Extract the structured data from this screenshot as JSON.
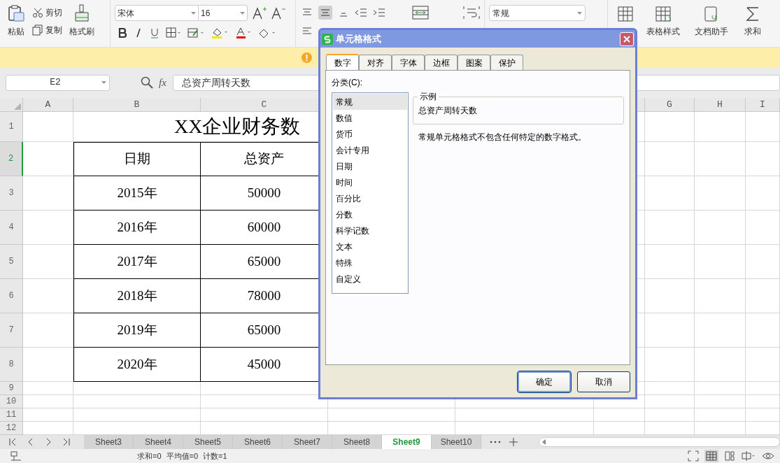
{
  "ribbon": {
    "paste": "粘贴",
    "cut": "剪切",
    "copy": "复制",
    "format_painter": "格式刷",
    "font_name": "宋体",
    "font_size": "16",
    "number_format": "常规",
    "right_buttons": [
      {
        "label": "表格样式"
      },
      {
        "label": "文档助手"
      },
      {
        "label": "求和"
      }
    ]
  },
  "formula_bar": {
    "cell_ref": "E2",
    "fx": "fx",
    "value": "总资产周转天数"
  },
  "sheet": {
    "columns_left": [
      "A",
      "B",
      "C"
    ],
    "columns_right": [
      "G",
      "H",
      "I"
    ],
    "rows": [
      {
        "label": "1",
        "selected": false
      },
      {
        "label": "2",
        "selected": true
      },
      {
        "label": "3",
        "selected": false
      },
      {
        "label": "4",
        "selected": false
      },
      {
        "label": "5",
        "selected": false
      },
      {
        "label": "6",
        "selected": false
      },
      {
        "label": "7",
        "selected": false
      },
      {
        "label": "8",
        "selected": false
      },
      {
        "label": "9",
        "selected": false
      },
      {
        "label": "10",
        "selected": false
      },
      {
        "label": "11",
        "selected": false
      },
      {
        "label": "12",
        "selected": false
      }
    ],
    "title": "XX企业财务数",
    "table_header": [
      "日期",
      "总资产"
    ],
    "table_rows": [
      [
        "2015年",
        "50000"
      ],
      [
        "2016年",
        "60000"
      ],
      [
        "2017年",
        "65000"
      ],
      [
        "2018年",
        "78000"
      ],
      [
        "2019年",
        "65000"
      ],
      [
        "2020年",
        "45000"
      ]
    ]
  },
  "sheet_tabs": [
    {
      "label": "Sheet3",
      "selected": false
    },
    {
      "label": "Sheet4",
      "selected": false
    },
    {
      "label": "Sheet5",
      "selected": false
    },
    {
      "label": "Sheet6",
      "selected": false
    },
    {
      "label": "Sheet7",
      "selected": false
    },
    {
      "label": "Sheet8",
      "selected": false
    },
    {
      "label": "Sheet9",
      "selected": true
    },
    {
      "label": "Sheet10",
      "selected": false
    }
  ],
  "status_bar": {
    "sum": "求和=0",
    "average": "平均值=0",
    "count": "计数=1"
  },
  "dialog": {
    "title": "单元格格式",
    "tabs": [
      {
        "label": "数字",
        "selected": true
      },
      {
        "label": "对齐",
        "selected": false
      },
      {
        "label": "字体",
        "selected": false
      },
      {
        "label": "边框",
        "selected": false
      },
      {
        "label": "图案",
        "selected": false
      },
      {
        "label": "保护",
        "selected": false
      }
    ],
    "category_label": "分类(C):",
    "categories": [
      {
        "label": "常规",
        "selected": true
      },
      {
        "label": "数值",
        "selected": false
      },
      {
        "label": "货币",
        "selected": false
      },
      {
        "label": "会计专用",
        "selected": false
      },
      {
        "label": "日期",
        "selected": false
      },
      {
        "label": "时间",
        "selected": false
      },
      {
        "label": "百分比",
        "selected": false
      },
      {
        "label": "分数",
        "selected": false
      },
      {
        "label": "科学记数",
        "selected": false
      },
      {
        "label": "文本",
        "selected": false
      },
      {
        "label": "特殊",
        "selected": false
      },
      {
        "label": "自定义",
        "selected": false
      }
    ],
    "sample_label": "示例",
    "sample_value": "总资产周转天数",
    "description": "常规单元格格式不包含任何特定的数字格式。",
    "buttons": [
      {
        "label": "确定",
        "kind": "default"
      },
      {
        "label": "取消",
        "kind": "normal"
      }
    ]
  }
}
